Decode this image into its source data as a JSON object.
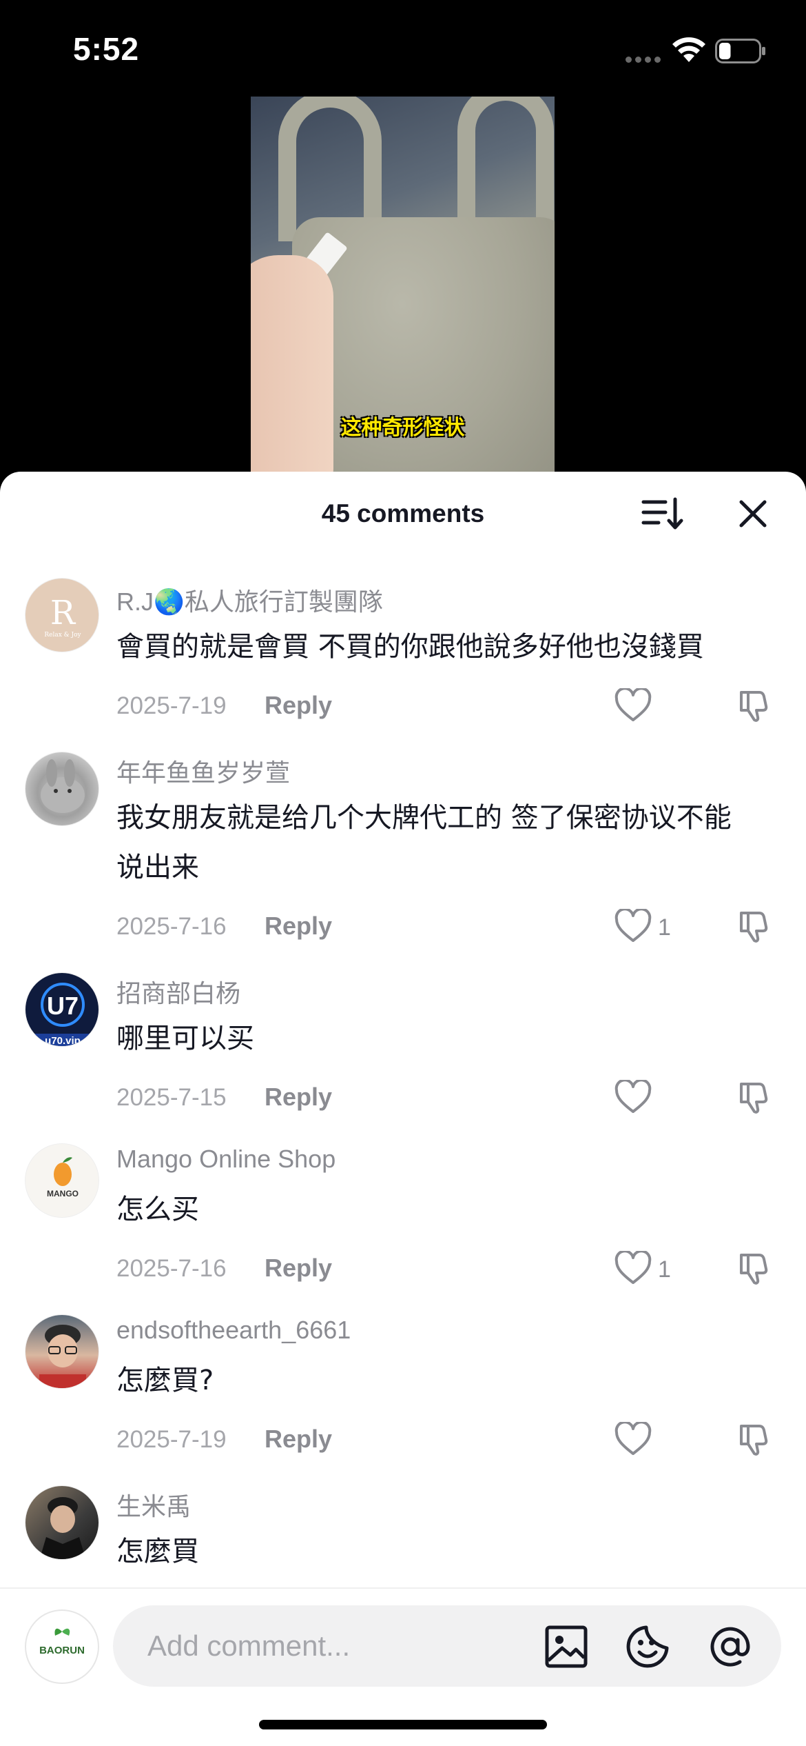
{
  "status_bar": {
    "time": "5:52",
    "battery_level": 0.3
  },
  "video": {
    "caption": "这种奇形怪状"
  },
  "sheet": {
    "title": "45 comments",
    "sort_icon": "sort-icon",
    "close_icon": "close-icon"
  },
  "comments": [
    {
      "user": "R.J🌏私人旅行訂製團隊",
      "text": "會買的就是會買 不買的你跟他說多好他也沒錢買",
      "date": "2025-7-19",
      "reply": "Reply",
      "likes": "",
      "avatar_text": "R",
      "avatar_sub": "Relax & Joy"
    },
    {
      "user": "年年鱼鱼岁岁萱",
      "text": "我女朋友就是给几个大牌代工的 签了保密协议不能说出来",
      "date": "2025-7-16",
      "reply": "Reply",
      "likes": "1"
    },
    {
      "user": "招商部白杨",
      "text": "哪里可以买",
      "date": "2025-7-15",
      "reply": "Reply",
      "likes": "",
      "avatar_text": "U7",
      "avatar_sub": "u70.vip"
    },
    {
      "user": "Mango Online Shop",
      "text": "怎么买",
      "date": "2025-7-16",
      "reply": "Reply",
      "likes": "1",
      "avatar_text": "MANGO"
    },
    {
      "user": "endsoftheearth_6661",
      "text": "怎麼買?",
      "date": "2025-7-19",
      "reply": "Reply",
      "likes": ""
    },
    {
      "user": "生米禹",
      "text": "怎麼買"
    }
  ],
  "composer": {
    "placeholder": "Add comment...",
    "avatar_text": "BAORUN",
    "icons": [
      "image-icon",
      "sticker-icon",
      "mention-icon"
    ]
  },
  "colors": {
    "accent_text": "#161823",
    "muted_text": "#8a8b91",
    "input_bg": "#f1f1f2"
  }
}
